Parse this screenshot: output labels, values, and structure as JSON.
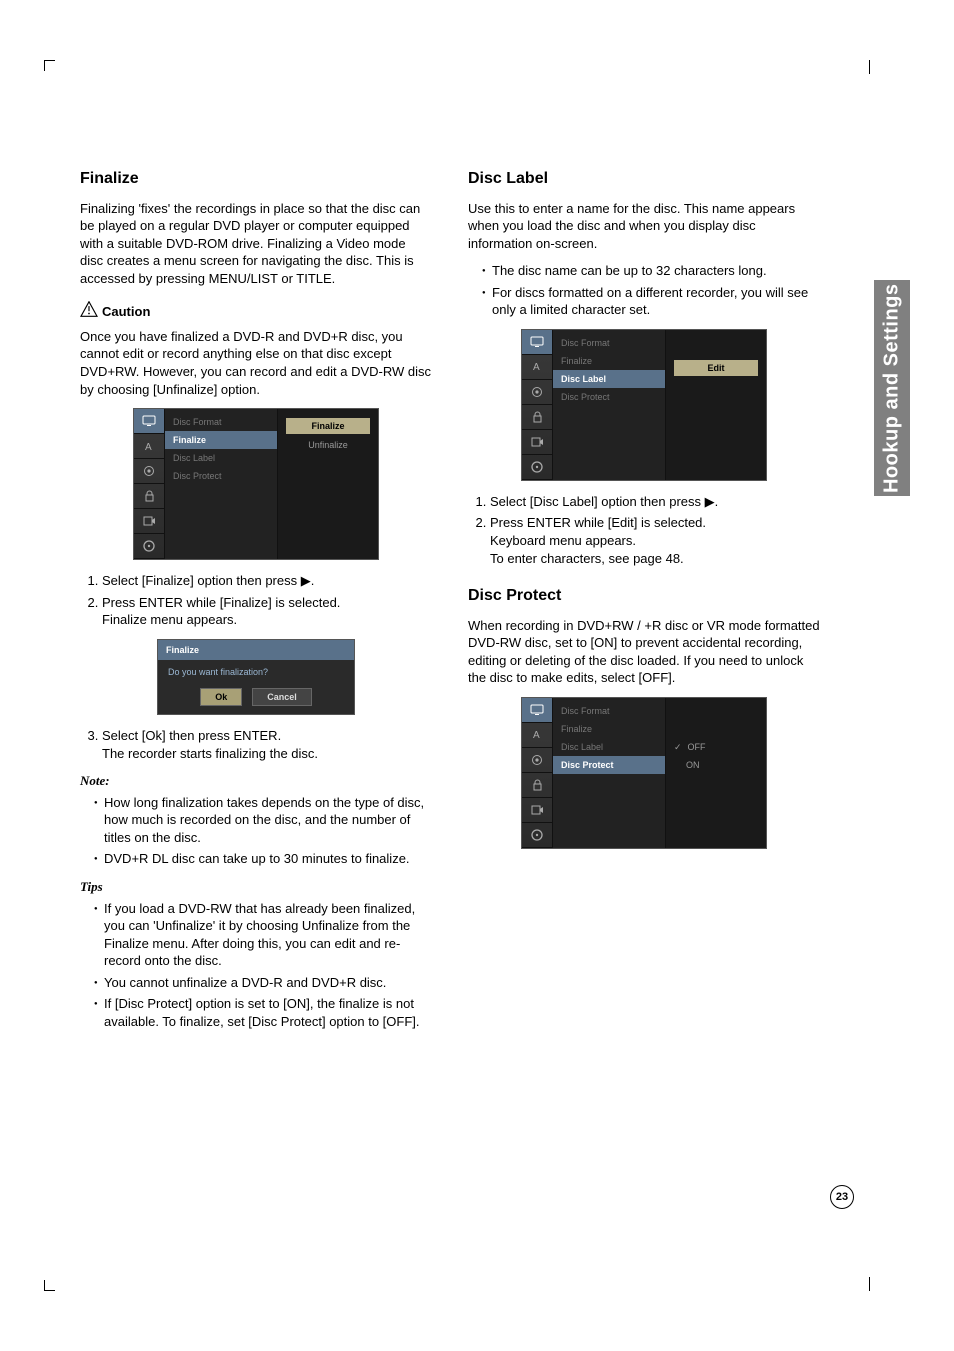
{
  "sidetab": "Hookup and Settings",
  "page_number": "23",
  "left": {
    "h_finalize": "Finalize",
    "p_finalize_intro": "Finalizing 'fixes' the recordings in place so that the disc can be played on a regular DVD player or computer equipped with a suitable DVD-ROM drive. Finalizing a Video mode disc creates a menu screen for navigating the disc. This is accessed by pressing MENU/LIST or TITLE.",
    "caution_label": "Caution",
    "caution_body": "Once you have finalized a DVD-R and DVD+R disc, you cannot edit or record anything else on that disc except DVD+RW. However, you can record and edit a DVD-RW disc by choosing [Unfinalize] option.",
    "osd1": {
      "menu": [
        "Disc Format",
        "Finalize",
        "Disc Label",
        "Disc Protect"
      ],
      "right": [
        "Finalize",
        "Unfinalize"
      ]
    },
    "step1": "Select [Finalize] option then press ▶.",
    "step2a": "Press ENTER while [Finalize] is selected.",
    "step2b": "Finalize menu appears.",
    "dlg": {
      "title": "Finalize",
      "msg": "Do you want finalization?",
      "ok": "Ok",
      "cancel": "Cancel"
    },
    "step3a": "Select [Ok] then press ENTER.",
    "step3b": "The recorder starts finalizing the disc.",
    "note_label": "Note:",
    "note1": "How long finalization takes depends on the type of disc, how much is recorded on the disc, and the number of titles on the disc.",
    "note2": "DVD+R DL disc can take up to 30 minutes to finalize.",
    "tips_label": "Tips",
    "tip1": "If you load a DVD-RW that has already been finalized, you can 'Unfinalize' it by choosing Unfinalize from the Finalize menu. After doing this, you can edit and re-record onto the disc.",
    "tip2": "You cannot unfinalize a DVD-R and DVD+R disc.",
    "tip3": "If [Disc Protect] option is set to [ON], the finalize is not available. To finalize, set [Disc Protect] option to [OFF]."
  },
  "right": {
    "h_label": "Disc Label",
    "p_label_intro": "Use this to enter a name for the disc. This name appears when you load the disc and when you display disc information on-screen.",
    "lbl_b1": "The disc name can be up to 32 characters long.",
    "lbl_b2": "For discs formatted on a different recorder, you will see only a limited character set.",
    "osd2": {
      "menu": [
        "Disc Format",
        "Finalize",
        "Disc Label",
        "Disc Protect"
      ],
      "right_btn": "Edit"
    },
    "lstep1": "Select [Disc Label] option then press ▶.",
    "lstep2a": "Press ENTER while [Edit] is selected.",
    "lstep2b": "Keyboard menu appears.",
    "lstep2c": "To enter characters, see page 48.",
    "h_protect": "Disc Protect",
    "p_protect": "When recording in DVD+RW / +R disc or VR mode formatted DVD-RW disc, set to [ON] to prevent accidental recording, editing or deleting of the disc loaded. If you need to unlock the disc to make edits, select [OFF].",
    "osd3": {
      "menu": [
        "Disc Format",
        "Finalize",
        "Disc Label",
        "Disc Protect"
      ],
      "right": [
        "OFF",
        "ON"
      ]
    }
  }
}
